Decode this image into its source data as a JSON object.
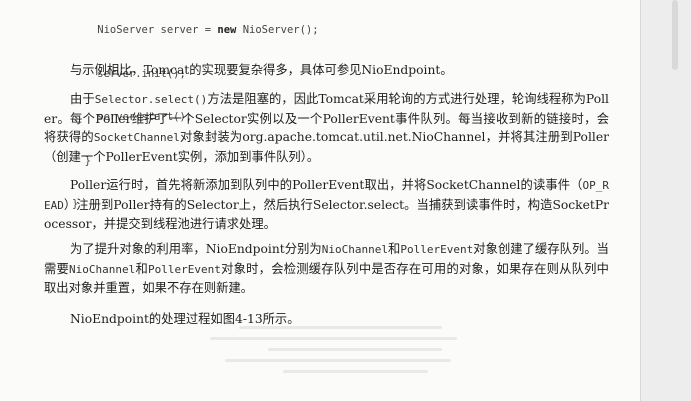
{
  "code": {
    "line1_prefix": "    NioServer server = ",
    "line1_keyword": "new",
    "line1_suffix": " NioServer();",
    "line2": "    server.init();",
    "line3": "    server.start();",
    "line4": "  }",
    "line5": "}"
  },
  "paragraphs": {
    "p1": "与示例相比，Tomcat的实现要复杂得多，具体可参见NioEndpoint。",
    "p2": {
      "a": "由于",
      "code1": "Selector.select()",
      "b": "方法是阻塞的，因此Tomcat采用轮询的方式进行处理，轮询线程称为Poller。每个Poller维护了一个Selector实例以及一个PollerEvent事件队列。每当接收到新的链接时，会将获得的",
      "code2": "SocketChannel",
      "c": "对象封装为org.apache.tomcat.util.net.NioChannel，并将其注册到Poller（创建一个PollerEvent实例，添加到事件队列）。"
    },
    "p3": {
      "a": "Poller运行时，首先将新添加到队列中的PollerEvent取出，并将SocketChannel的读事件（",
      "code1": "OP_READ",
      "b": "）注册到Poller持有的Selector上，然后执行Selector.select。当捕获到读事件时，构造SocketProcessor，并提交到线程池进行请求处理。"
    },
    "p4": {
      "a": "为了提升对象的利用率，NioEndpoint分别为",
      "code1": "NioChannel",
      "b": "和",
      "code2": "PollerEvent",
      "c": "对象创建了缓存队列。当需要",
      "code3": "NioChannel",
      "d": "和",
      "code4": "PollerEvent",
      "e": "对象时，会检测缓存队列中是否存在可用的对象，如果存在则从队列中取出对象并重置，如果不存在则新建。"
    },
    "p5": "NioEndpoint的处理过程如图4-13所示。"
  }
}
